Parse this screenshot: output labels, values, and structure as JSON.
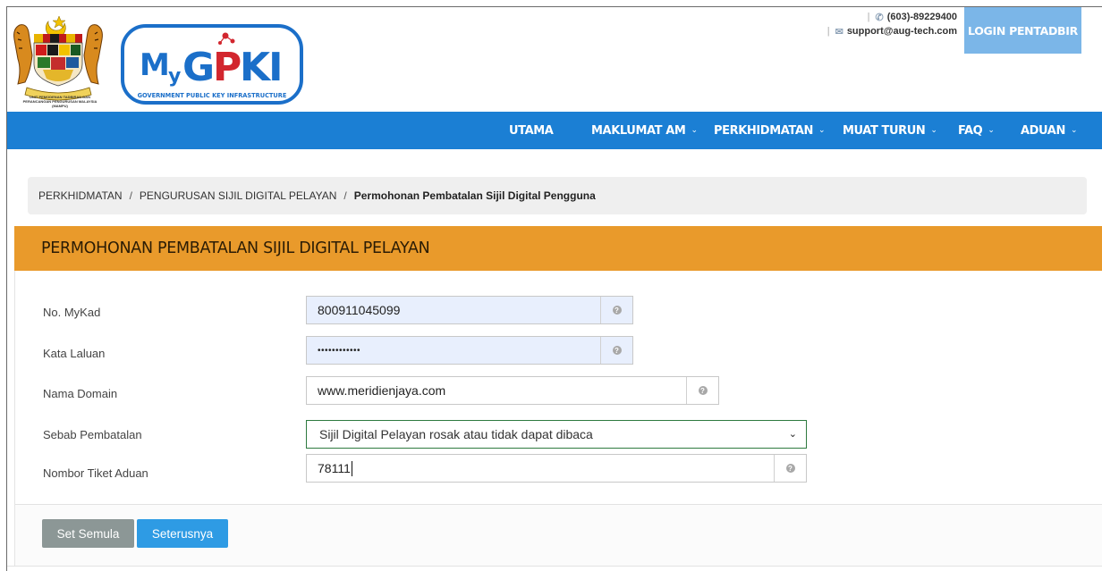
{
  "header": {
    "crest_caption": [
      "UNIT PEMODENAN TADBIRAN DAN",
      "PERANCANGAN PENGURUSAN MALAYSIA",
      "(MAMPU)"
    ],
    "logo_text": "MyGPKI",
    "logo_subtitle": "GOVERNMENT PUBLIC KEY INFRASTRUCTURE",
    "phone": "(603)-89229400",
    "email": "support@aug-tech.com",
    "login_label": "LOGIN PENTADBIR"
  },
  "nav": {
    "items": [
      {
        "label": "UTAMA",
        "has_dropdown": false
      },
      {
        "label": "MAKLUMAT AM",
        "has_dropdown": true
      },
      {
        "label": "PERKHIDMATAN",
        "has_dropdown": true
      },
      {
        "label": "MUAT TURUN",
        "has_dropdown": true
      },
      {
        "label": "FAQ",
        "has_dropdown": true
      },
      {
        "label": "ADUAN",
        "has_dropdown": true
      }
    ]
  },
  "breadcrumb": {
    "items": [
      "PERKHIDMATAN",
      "PENGURUSAN SIJIL DIGITAL PELAYAN"
    ],
    "current": "Permohonan Pembatalan Sijil Digital Pengguna",
    "separator": "/"
  },
  "panel": {
    "title": "PERMOHONAN PEMBATALAN SIJIL DIGITAL PELAYAN",
    "header_color": "#e99a2b"
  },
  "form": {
    "mykad": {
      "label": "No. MyKad",
      "value": "800911045099"
    },
    "password": {
      "label": "Kata Laluan",
      "value": "••••••••••••"
    },
    "domain": {
      "label": "Nama Domain",
      "value": "www.meridienjaya.com"
    },
    "reason": {
      "label": "Sebab Pembatalan",
      "selected": "Sijil Digital Pelayan rosak atau tidak dapat dibaca"
    },
    "ticket": {
      "label": "Nombor Tiket Aduan",
      "value": "78111"
    }
  },
  "buttons": {
    "reset": "Set Semula",
    "next": "Seterusnya"
  },
  "colors": {
    "nav": "#1b7fd4",
    "login": "#7bb6e8",
    "reset": "#8c9796",
    "next": "#2e9be4"
  }
}
